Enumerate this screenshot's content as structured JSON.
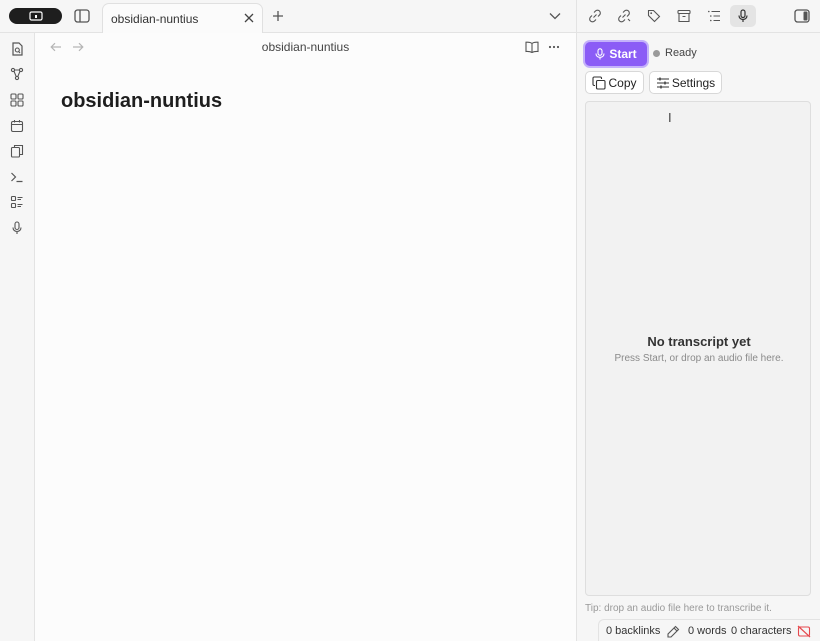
{
  "tabbar": {
    "tab_title": "obsidian-nuntius"
  },
  "note": {
    "view_title": "obsidian-nuntius",
    "heading": "obsidian-nuntius"
  },
  "panel": {
    "start_label": "Start",
    "status": "Ready",
    "copy_label": "Copy",
    "settings_label": "Settings",
    "empty_title": "No transcript yet",
    "empty_subtitle": "Press Start, or drop an audio file here.",
    "tip": "Tip: drop an audio file here to transcribe it."
  },
  "statusbar": {
    "backlinks": "0 backlinks",
    "words": "0 words",
    "characters": "0 characters"
  },
  "colors": {
    "accent": "#8b5cf6",
    "sync_error": "#e5484d"
  },
  "icons": {
    "ribbon": [
      "open-quick-switcher-icon",
      "graph-icon",
      "canvas-icon",
      "calendar-icon",
      "templates-icon",
      "terminal-icon",
      "command-list-icon",
      "microphone-icon"
    ],
    "right_tabs": [
      "backlinks-icon",
      "outgoing-links-icon",
      "tags-icon",
      "archive-icon",
      "outline-icon",
      "microphone-icon"
    ]
  }
}
